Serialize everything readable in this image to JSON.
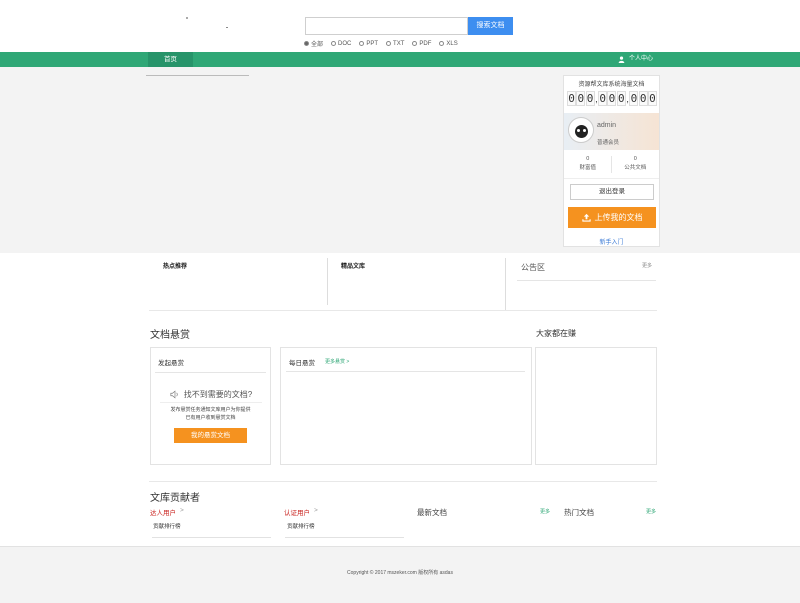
{
  "search": {
    "placeholder": "",
    "button_label": "搜索文档",
    "filters": [
      {
        "label": "全部",
        "selected": true
      },
      {
        "label": "DOC",
        "selected": false
      },
      {
        "label": "PPT",
        "selected": false
      },
      {
        "label": "TXT",
        "selected": false
      },
      {
        "label": "PDF",
        "selected": false
      },
      {
        "label": "XLS",
        "selected": false
      }
    ]
  },
  "nav": {
    "home": "首页",
    "user_center": "个人中心"
  },
  "sidebar": {
    "title": "资源帮文库系统海量文档",
    "counter_digits": [
      "0",
      "0",
      "0",
      "0",
      "0",
      "0",
      "0",
      "0",
      "0"
    ],
    "counter_sep": ",",
    "username": "admin",
    "role": "普通会员",
    "stats": [
      {
        "value": "0",
        "label": "财富值"
      },
      {
        "value": "0",
        "label": "公共文档"
      }
    ],
    "logout": "退出登录",
    "upload": "上传我的文档",
    "newbie": "新手入门"
  },
  "middle": {
    "hot": "热点推荐",
    "featured": "精品文库",
    "notice": "公告区",
    "notice_more": "更多"
  },
  "bounty": {
    "section_title": "文档悬赏",
    "launch_title": "发起悬赏",
    "not_found": "找不到需要的文档?",
    "desc_line1": "发布悬赏任务通知文库用户为你提供",
    "desc_line2": "已有用户收到悬赏文档",
    "button": "我的悬赏文档",
    "daily_title": "每日悬赏",
    "daily_more": "更多悬赏 >",
    "earning_title": "大家都在赚"
  },
  "contrib": {
    "section_title": "文库贡献者",
    "talent": "达人用户",
    "certified": "认证用户",
    "chevron": ">",
    "rank1": "贡献排行榜",
    "rank2": "贡献排行榜",
    "latest": "最新文档",
    "latest_more": "更多",
    "hot_docs": "热门文档",
    "hot_more": "更多"
  },
  "footer": {
    "copyright": "Copyright © 2017 mszeker.com 版权所有 asdas"
  },
  "colors": {
    "brand_green": "#2fa776",
    "accent_orange": "#f5921f",
    "search_blue": "#3d8ef0",
    "red": "#c9201c"
  }
}
